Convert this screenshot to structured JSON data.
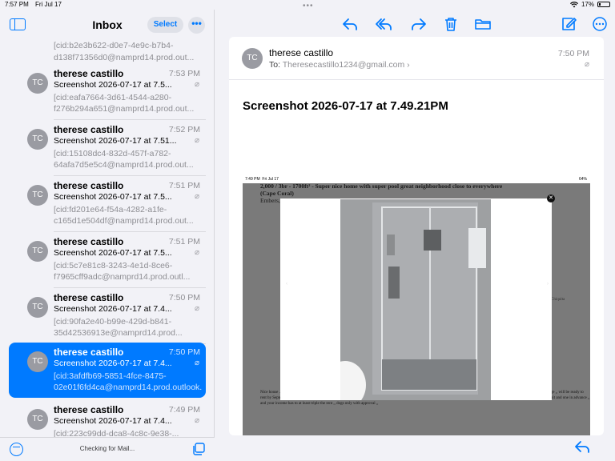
{
  "status_bar": {
    "time": "7:57 PM",
    "date": "Fri Jul 17",
    "battery": "17%"
  },
  "sidebar": {
    "title": "Inbox",
    "select_label": "Select",
    "more_label": "•••",
    "status_text": "Checking for Mail...",
    "partial_preview": "[cid:b2e3b622-d0e7-4e9c-b7b4-d138f71356d0@namprd14.prod.out...",
    "messages": [
      {
        "initials": "TC",
        "sender": "therese castillo",
        "time": "7:53 PM",
        "subject": "Screenshot 2026-07-17 at 7.5...",
        "preview": "[cid:eafa7664-3d61-4544-a280-f276b294a651@namprd14.prod.out...",
        "selected": false
      },
      {
        "initials": "TC",
        "sender": "therese castillo",
        "time": "7:52 PM",
        "subject": "Screenshot 2026-07-17 at 7.51...",
        "preview": "[cid:15108dc4-832d-457f-a782-64afa7d5e5c4@namprd14.prod.out...",
        "selected": false
      },
      {
        "initials": "TC",
        "sender": "therese castillo",
        "time": "7:51 PM",
        "subject": "Screenshot 2026-07-17 at 7.5...",
        "preview": "[cid:fd201e64-f54a-4282-a1fe-c165d1e504df@namprd14.prod.out...",
        "selected": false
      },
      {
        "initials": "TC",
        "sender": "therese castillo",
        "time": "7:51 PM",
        "subject": "Screenshot 2026-07-17 at 7.5...",
        "preview": "[cid:5c7e81c8-3243-4e1d-8ce6-f7965cff9adc@namprd14.prod.outl...",
        "selected": false
      },
      {
        "initials": "TC",
        "sender": "therese castillo",
        "time": "7:50 PM",
        "subject": "Screenshot 2026-07-17 at 7.4...",
        "preview": "[cid:90fa2e40-b99e-429d-b841-35d42536913e@namprd14.prod...",
        "selected": false
      },
      {
        "initials": "TC",
        "sender": "therese castillo",
        "time": "7:50 PM",
        "subject": "Screenshot 2026-07-17 at 7.4...",
        "preview": "[cid:3afdfb69-5851-4fce-8475-02e01f6fd4ca@namprd14.prod.outlook...",
        "selected": true
      },
      {
        "initials": "TC",
        "sender": "therese castillo",
        "time": "7:49 PM",
        "subject": "Screenshot 2026-07-17 at 7.4...",
        "preview": "[cid:223c99dd-dca8-4c8c-9e38-...",
        "selected": false
      }
    ]
  },
  "toolbar": {
    "icons": [
      "reply-icon",
      "reply-all-icon",
      "forward-icon",
      "trash-icon",
      "folder-icon",
      "compose-icon",
      "more-icon"
    ]
  },
  "message": {
    "initials": "TC",
    "sender": "therese castillo",
    "to_label": "To:",
    "to_address": "Theresecastillo1234@gmail.com",
    "time": "7:50 PM",
    "subject": "Screenshot 2026-07-17 at 7.49.21PM"
  },
  "embedded": {
    "status_time": "7:49 PM",
    "status_date": "Fri Jul 17",
    "status_battery": "64%",
    "listing_title": "2,000 / 3br - 1700ft² - Super nice home with super pool great neighborhood close to everywhere",
    "listing_location_bold": "(Cape Coral)",
    "listing_area": "Embers, Cape Coral, FL 33990",
    "listing_body": "Nice house ... huge family room ... bathroom ... from living room ,, and updated kitchen also with granite ,, double door on front and two car garage laundry area separated from garage ,, will be ready to rent by September 4 th currently tenants in place ,, we are the owners and we request background check ,, proof of income steady job preferred local ,, we ask 2 months security deposit and one in advance ,, and your income has to at least triple the rent ,, dogs only with approval ,,",
    "side_label": "Chiquita",
    "close_label": "✕"
  },
  "colors": {
    "accent": "#007aff",
    "avatar": "#9a9ba2",
    "selected_row": "#007aff"
  }
}
